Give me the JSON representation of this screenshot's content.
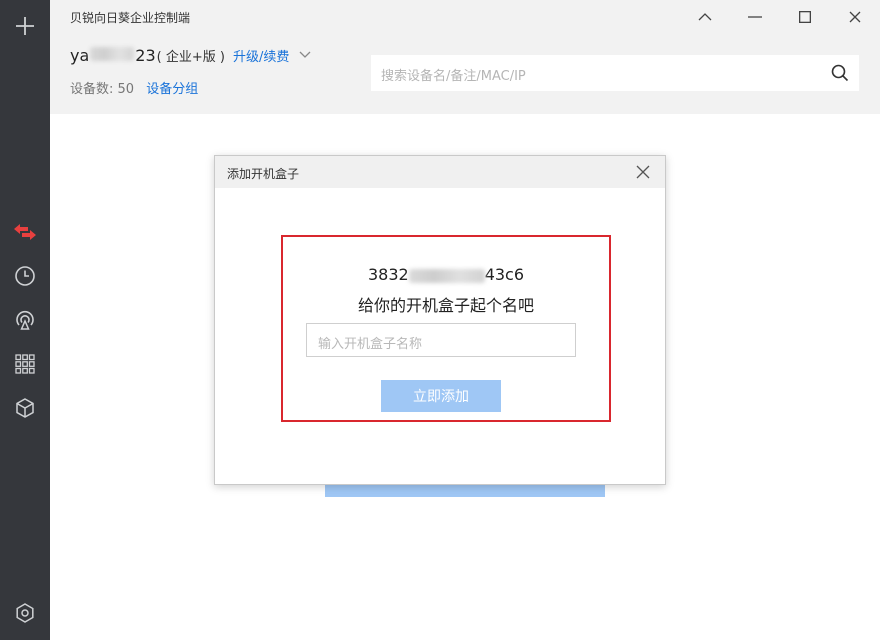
{
  "app": {
    "title": "贝锐向日葵企业控制端"
  },
  "header": {
    "account_prefix": "ya",
    "account_suffix": "23",
    "edition": "( 企业+版 )",
    "upgrade_label": "升级/续费",
    "devices_label": "设备数: ",
    "devices_count": "50",
    "device_group_label": "设备分组",
    "search_placeholder": "搜索设备名/备注/MAC/IP"
  },
  "sidebar": {
    "items": [
      {
        "icon": "plus-icon"
      },
      {
        "icon": "remote-control-icon",
        "active": true
      },
      {
        "icon": "history-clock-icon"
      },
      {
        "icon": "broadcast-icon"
      },
      {
        "icon": "grid-apps-icon"
      },
      {
        "icon": "box-cube-icon"
      },
      {
        "icon": "settings-icon"
      }
    ]
  },
  "dialog": {
    "title": "添加开机盒子",
    "box_id_prefix": "3832",
    "box_id_suffix": "43c6",
    "prompt": "给你的开机盒子起个名吧",
    "name_placeholder": "输入开机盒子名称",
    "add_button": "立即添加"
  },
  "colors": {
    "sidebar_bg": "#35373c",
    "accent_blue": "#1a73d9",
    "button_disabled_blue": "#9fc7f5",
    "highlight_red": "#d9272e",
    "active_icon_red": "#e8403f"
  }
}
